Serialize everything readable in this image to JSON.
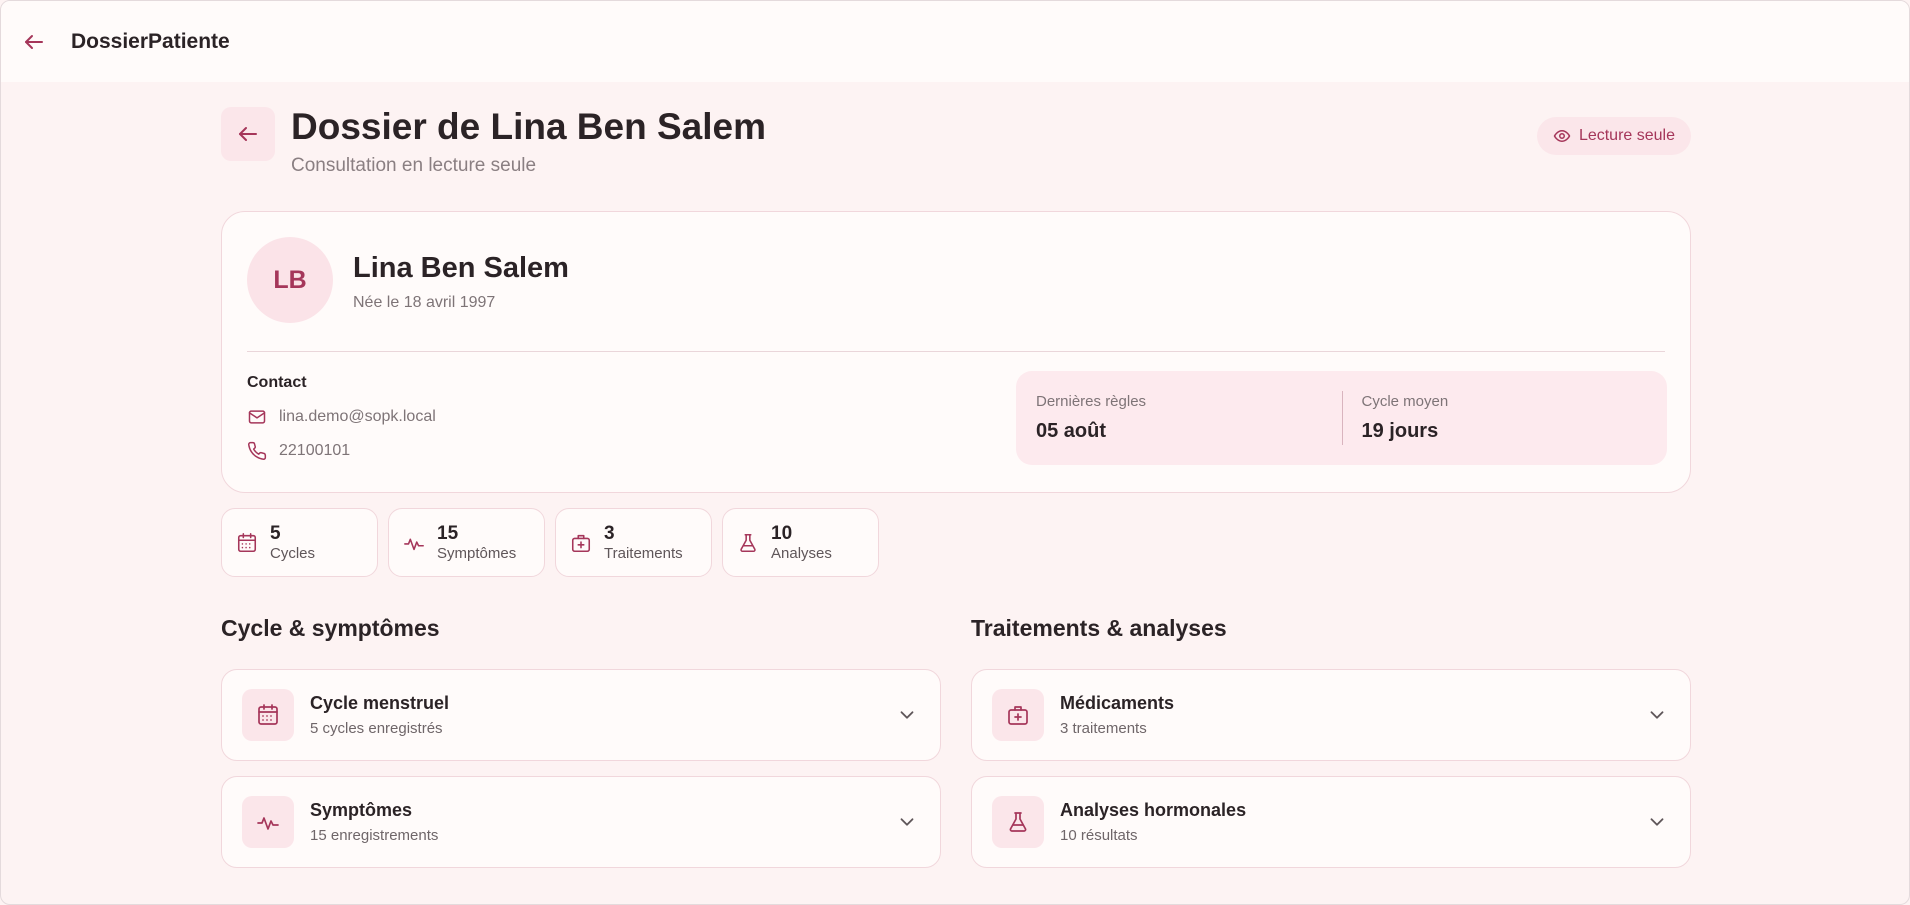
{
  "app": {
    "title": "DossierPatiente"
  },
  "page": {
    "title": "Dossier de Lina Ben Salem",
    "subtitle": "Consultation en lecture seule",
    "readonly_badge": "Lecture seule"
  },
  "patient": {
    "initials": "LB",
    "name": "Lina Ben Salem",
    "dob": "Née le 18 avril 1997",
    "contact_heading": "Contact",
    "email": "lina.demo@sopk.local",
    "phone": "22100101",
    "last_period_label": "Dernières règles",
    "last_period_value": "05 août",
    "avg_cycle_label": "Cycle moyen",
    "avg_cycle_value": "19 jours"
  },
  "stats": [
    {
      "value": "5",
      "label": "Cycles",
      "icon": "calendar-icon"
    },
    {
      "value": "15",
      "label": "Symptômes",
      "icon": "pulse-icon"
    },
    {
      "value": "3",
      "label": "Traitements",
      "icon": "medical-kit-icon"
    },
    {
      "value": "10",
      "label": "Analyses",
      "icon": "flask-icon"
    }
  ],
  "sections": {
    "left_heading": "Cycle & symptômes",
    "right_heading": "Traitements & analyses",
    "cycle": {
      "title": "Cycle menstruel",
      "subtitle": "5 cycles enregistrés"
    },
    "symptoms": {
      "title": "Symptômes",
      "subtitle": "15 enregistrements"
    },
    "meds": {
      "title": "Médicaments",
      "subtitle": "3 traitements"
    },
    "analyses": {
      "title": "Analyses hormonales",
      "subtitle": "10 résultats"
    }
  },
  "colors": {
    "accent": "#a5365a",
    "background": "#fdf3f3",
    "card": "#fffbfa",
    "soft": "#fbe6ea"
  }
}
